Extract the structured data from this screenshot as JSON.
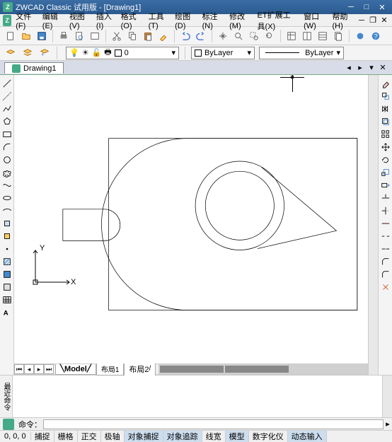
{
  "title": "ZWCAD Classic 试用版 - [Drawing1]",
  "menu": {
    "file": "文件(F)",
    "edit": "编辑(E)",
    "view": "视图(V)",
    "insert": "插入(I)",
    "format": "格式(O)",
    "tools": "工具(T)",
    "draw": "绘图(D)",
    "dimension": "标注(N)",
    "modify": "修改(M)",
    "ettools": "ET扩展工具(X)",
    "window": "窗口(W)",
    "help": "帮助(H)"
  },
  "layer": {
    "name": "0",
    "bylayer": "ByLayer",
    "linetype": "ByLayer"
  },
  "doctab": "Drawing1",
  "sheets": {
    "model": "Model",
    "layout1": "布局1",
    "layout2": "布局2"
  },
  "ucs": {
    "y": "Y",
    "x": "X"
  },
  "cmdlabel": "最近命令",
  "cmdprompt": "命令：",
  "coord": "0, 0, 0",
  "status": {
    "snap": "捕捉",
    "grid": "栅格",
    "ortho": "正交",
    "polar": "极轴",
    "osnap": "对象捕捉",
    "otrack": "对象追踪",
    "lweight": "线宽",
    "model": "模型",
    "digitizer": "数字化仪",
    "dyn": "动态输入"
  }
}
